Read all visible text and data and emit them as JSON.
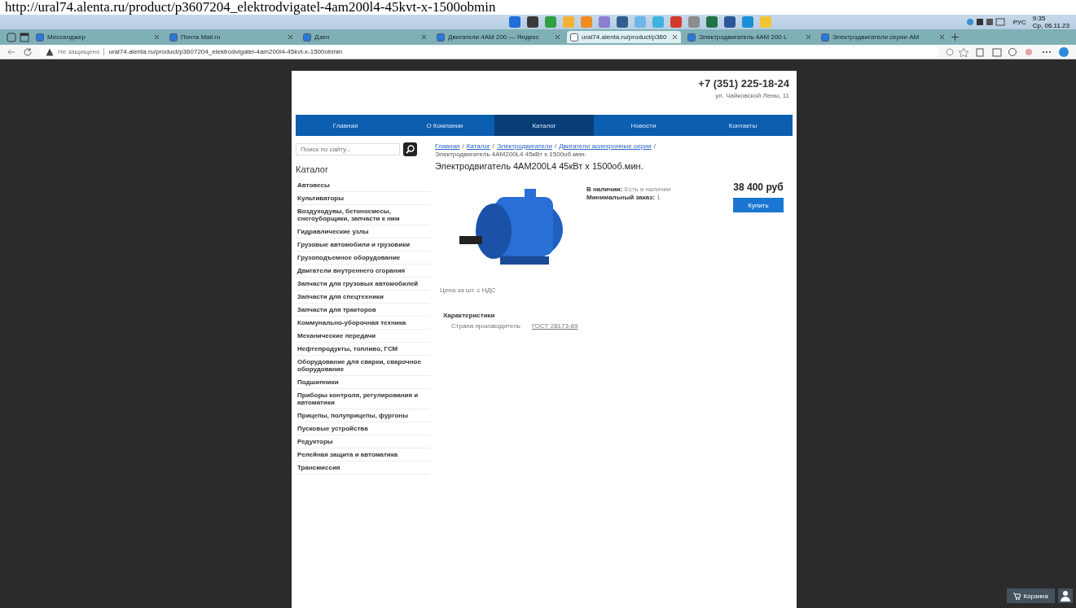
{
  "caption_text": "http://ural74.alenta.ru/product/p3607204_elektrodvigatel-4am200l4-45kvt-x-1500obmin",
  "taskbar": {
    "language": "РУС",
    "clock_time": "9:35",
    "clock_date": "Ср, 06.11.23"
  },
  "browser": {
    "tabs": [
      {
        "label": "Мессенджер",
        "selected": false
      },
      {
        "label": "Почта Mail.ru",
        "selected": false
      },
      {
        "label": "Дзен",
        "selected": false
      },
      {
        "label": "Двигатели 4АМ 200 — Яндекс",
        "selected": false
      },
      {
        "label": "ural74.alenta.ru/product/p360",
        "selected": true
      },
      {
        "label": "Электродвигатель 4АМ 200 L",
        "selected": false
      },
      {
        "label": "Электродвигатели серии АМ",
        "selected": false
      }
    ],
    "address": {
      "security": "Не защищено",
      "url": "ural74.alenta.ru/product/p3607204_elektrodvigatel-4am200l4-45kvt-x-1500obmin"
    }
  },
  "site": {
    "phone": "+7 (351) 225-18-24",
    "street": "ул. Чайковской Лены, 11",
    "nav": [
      {
        "label": "Главная",
        "selected": false
      },
      {
        "label": "О Компании",
        "selected": false
      },
      {
        "label": "Каталог",
        "selected": true
      },
      {
        "label": "Новости",
        "selected": false
      },
      {
        "label": "Контакты",
        "selected": false
      }
    ],
    "search": {
      "placeholder": "Поиск по сайту..."
    },
    "catalog": {
      "title": "Каталог",
      "items": [
        "Автовесы",
        "Культиваторы",
        "Воздуходувы, бетоносмесы, снегоуборщики, запчасти к ним",
        "Гидравлические узлы",
        "Грузовые автомобили и грузовики",
        "Грузоподъемное оборудование",
        "Двигатели внутреннего сгорания",
        "Запчасти для грузовых автомобилей",
        "Запчасти для спецтехники",
        "Запчасти для тракторов",
        "Коммунально-уборочная техника",
        "Механические передачи",
        "Нефтепродукты, топливо, ГСМ",
        "Оборудование для сварки, сварочное оборудование",
        "Подшипники",
        "Приборы контроля, регулирования и автоматики",
        "Прицепы, полуприцепы, фургоны",
        "Пусковые устройства",
        "Редукторы",
        "Релейная защита и автоматика",
        "Трансмиссия"
      ]
    },
    "breadcrumbs": [
      {
        "kind": "link",
        "label": "Главная"
      },
      {
        "kind": "separator",
        "label": "/"
      },
      {
        "kind": "link",
        "label": "Каталог"
      },
      {
        "kind": "separator",
        "label": "/"
      },
      {
        "kind": "link",
        "label": "Электродвигатели"
      },
      {
        "kind": "separator",
        "label": "/"
      },
      {
        "kind": "link",
        "label": "Двигатели асинхронные серии"
      },
      {
        "kind": "separator",
        "label": "/"
      },
      {
        "kind": "current",
        "label": "Электродвигатель 4АМ200L4 45кВт х 1500об.мин."
      }
    ],
    "product": {
      "title": "Электродвигатель 4АМ200L4 45кВт х 1500об.мин.",
      "availability_label": "В наличии:",
      "availability_value": "Есть в наличии",
      "min_order_label": "Минимальный заказ:",
      "min_order_value": "1",
      "price": "38 400 руб",
      "buy_button": "Купить",
      "price_note": "Цена за шт. с НДС",
      "specs_title": "Характеристики",
      "specs": [
        {
          "name": "Страна производитель",
          "value": "ГОСТ 28173-89"
        }
      ]
    }
  },
  "cart_widget": {
    "label": "Корзина"
  }
}
